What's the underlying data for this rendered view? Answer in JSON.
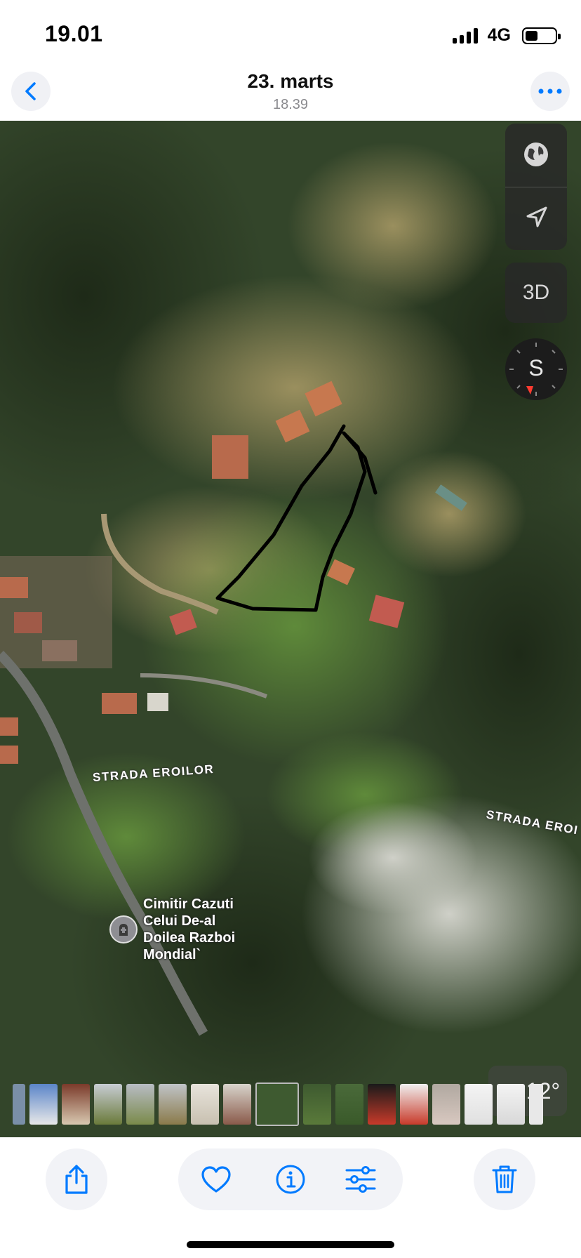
{
  "status_bar": {
    "time": "19.01",
    "network": "4G",
    "battery_percent": 42,
    "signal_bars": 4
  },
  "header": {
    "title": "23. marts",
    "subtitle": "18.39"
  },
  "map": {
    "controls": {
      "globe_icon": "globe-icon",
      "location_icon": "location-arrow-icon",
      "three_d_label": "3D",
      "compass_label": "S"
    },
    "street_labels": [
      "STRADA EROILOR",
      "STRADA EROI"
    ],
    "poi": {
      "icon": "cemetery-icon",
      "label_lines": [
        "Cimitir Cazuti",
        "Celui De-al",
        "Doilea Razboi",
        "Mondial`"
      ]
    },
    "weather": {
      "icon": "cloud-icon",
      "temperature": "12°"
    }
  },
  "thumbnails": {
    "count": 17,
    "selected_index": 8
  },
  "toolbar": {
    "share_icon": "share-icon",
    "favorite_icon": "heart-icon",
    "info_icon": "info-icon",
    "adjust_icon": "sliders-icon",
    "delete_icon": "trash-icon"
  },
  "colors": {
    "accent": "#007aff"
  }
}
